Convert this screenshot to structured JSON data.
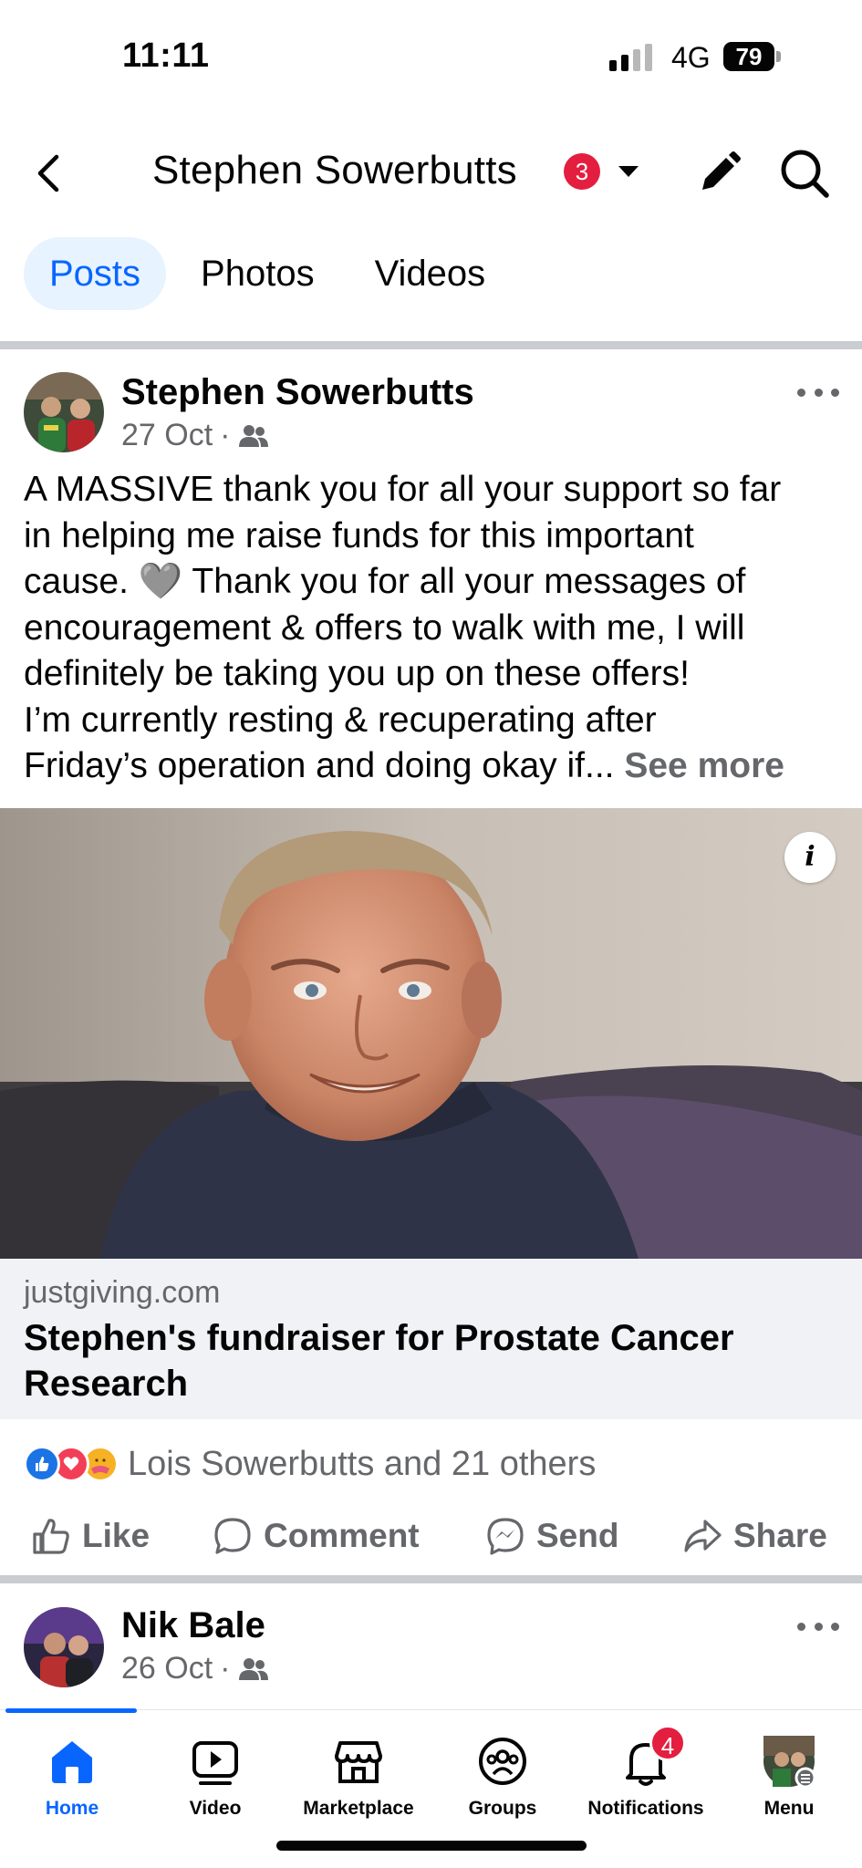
{
  "status_bar": {
    "time": "11:11",
    "network": "4G",
    "battery": "79"
  },
  "header": {
    "title": "Stephen Sowerbutts",
    "badge": "3"
  },
  "tabs": [
    {
      "label": "Posts",
      "active": true
    },
    {
      "label": "Photos",
      "active": false
    },
    {
      "label": "Videos",
      "active": false
    }
  ],
  "post": {
    "author": "Stephen Sowerbutts",
    "date": "27 Oct",
    "separator": "·",
    "audience_icon": "friends-icon",
    "text_lines": [
      "A MASSIVE thank you for all your support so far",
      "in helping me raise funds for this important",
      "cause. 🩶 Thank you for all your messages of",
      "encouragement & offers to walk with me, I will",
      "definitely be taking you up on these offers!",
      "I’m currently resting & recuperating after",
      "Friday’s operation and doing okay if..."
    ],
    "see_more": "See more",
    "info_label": "i",
    "link": {
      "domain": "justgiving.com",
      "title": "Stephen's fundraiser for Prostate Cancer Research"
    },
    "reactions": {
      "icons": [
        "like-reaction-icon",
        "love-reaction-icon",
        "care-reaction-icon"
      ],
      "text": "Lois Sowerbutts and 21 others"
    },
    "actions": [
      {
        "label": "Like",
        "icon": "thumbs-up-icon"
      },
      {
        "label": "Comment",
        "icon": "comment-icon"
      },
      {
        "label": "Send",
        "icon": "messenger-icon"
      },
      {
        "label": "Share",
        "icon": "share-icon"
      }
    ]
  },
  "next_post": {
    "author": "Nik Bale",
    "date": "26 Oct",
    "separator": "·",
    "audience_icon": "friends-icon"
  },
  "bottom_nav": [
    {
      "label": "Home",
      "icon": "home-icon",
      "active": true
    },
    {
      "label": "Video",
      "icon": "video-icon",
      "active": false
    },
    {
      "label": "Marketplace",
      "icon": "marketplace-icon",
      "active": false
    },
    {
      "label": "Groups",
      "icon": "groups-icon",
      "active": false
    },
    {
      "label": "Notifications",
      "icon": "bell-icon",
      "active": false,
      "badge": "4"
    },
    {
      "label": "Menu",
      "icon": "menu-avatar-icon",
      "active": false
    }
  ],
  "colors": {
    "accent": "#0866ff",
    "badge": "#e41e3f",
    "secondary_text": "#65676b",
    "divider": "#c9ccd1"
  }
}
